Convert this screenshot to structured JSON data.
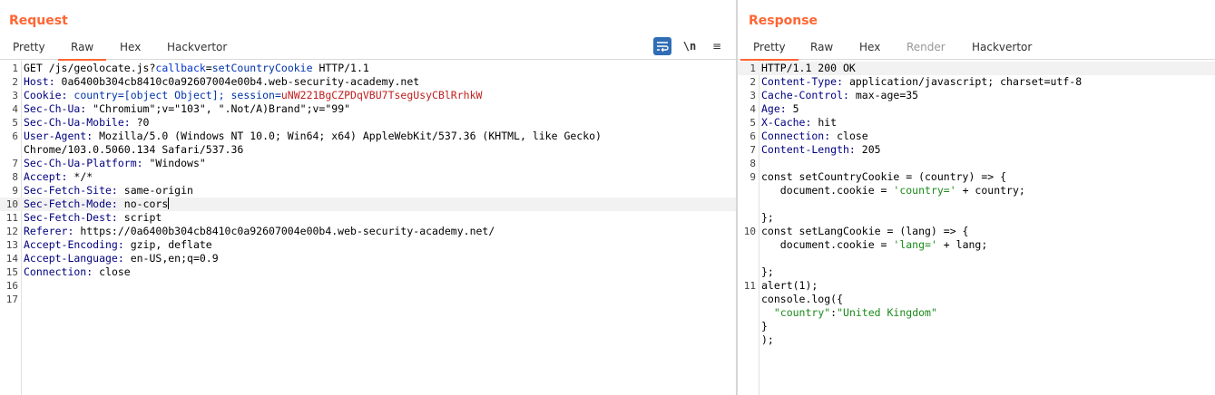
{
  "request": {
    "title": "Request",
    "tabs": [
      "Pretty",
      "Raw",
      "Hex",
      "Hackvertor"
    ],
    "active_tab": "Raw",
    "tools": {
      "newline_label": "\\n",
      "menu_label": "≡"
    },
    "lines": [
      {
        "n": "1",
        "method": "GET /js/geolocate.js?",
        "param": "callback",
        "eq": "=",
        "pvalue": "setCountryCookie",
        "rest": " HTTP/1.1"
      },
      {
        "n": "2",
        "key": "Host:",
        "value": " 0a6400b304cb8410c0a92607004e00b4.web-security-academy.net"
      },
      {
        "n": "3",
        "key": "Cookie:",
        "c1": " country=[object Object]; session=",
        "c2": "uNW221BgCZPDqVBU7TsegUsyCBlRrhkW"
      },
      {
        "n": "4",
        "key": "Sec-Ch-Ua:",
        "value": " \"Chromium\";v=\"103\", \".Not/A)Brand\";v=\"99\""
      },
      {
        "n": "5",
        "key": "Sec-Ch-Ua-Mobile:",
        "value": " ?0"
      },
      {
        "n": "6",
        "key": "User-Agent:",
        "value": " Mozilla/5.0 (Windows NT 10.0; Win64; x64) AppleWebKit/537.36 (KHTML, like Gecko)",
        "cont": "Chrome/103.0.5060.134 Safari/537.36"
      },
      {
        "n": "7",
        "key": "Sec-Ch-Ua-Platform:",
        "value": " \"Windows\""
      },
      {
        "n": "8",
        "key": "Accept:",
        "value": " */*"
      },
      {
        "n": "9",
        "key": "Sec-Fetch-Site:",
        "value": " same-origin"
      },
      {
        "n": "10",
        "key": "Sec-Fetch-Mode:",
        "value": " no-cors"
      },
      {
        "n": "11",
        "key": "Sec-Fetch-Dest:",
        "value": " script"
      },
      {
        "n": "12",
        "key": "Referer:",
        "value": " https://0a6400b304cb8410c0a92607004e00b4.web-security-academy.net/"
      },
      {
        "n": "13",
        "key": "Accept-Encoding:",
        "value": " gzip, deflate"
      },
      {
        "n": "14",
        "key": "Accept-Language:",
        "value": " en-US,en;q=0.9"
      },
      {
        "n": "15",
        "key": "Connection:",
        "value": " close"
      },
      {
        "n": "16"
      },
      {
        "n": "17"
      }
    ]
  },
  "response": {
    "title": "Response",
    "tabs": [
      "Pretty",
      "Raw",
      "Hex",
      "Render",
      "Hackvertor"
    ],
    "active_tab": "Pretty",
    "lines": [
      {
        "n": "1",
        "text": "HTTP/1.1 200 OK"
      },
      {
        "n": "2",
        "key": "Content-Type:",
        "value": " application/javascript; charset=utf-8"
      },
      {
        "n": "3",
        "key": "Cache-Control:",
        "value": " max-age=35"
      },
      {
        "n": "4",
        "key": "Age:",
        "value": " 5"
      },
      {
        "n": "5",
        "key": "X-Cache:",
        "value": " hit"
      },
      {
        "n": "6",
        "key": "Connection:",
        "value": " close"
      },
      {
        "n": "7",
        "key": "Content-Length:",
        "value": " 205"
      },
      {
        "n": "8"
      },
      {
        "n": "9",
        "text": "const setCountryCookie = (country) => {"
      },
      {
        "n": "",
        "pre": "   document.cookie = ",
        "str": "'country='",
        "post": " + country;"
      },
      {
        "n": ""
      },
      {
        "n": "",
        "text": "};"
      },
      {
        "n": "10",
        "text": "const setLangCookie = (lang) => {"
      },
      {
        "n": "",
        "pre": "   document.cookie = ",
        "str": "'lang='",
        "post": " + lang;"
      },
      {
        "n": ""
      },
      {
        "n": "",
        "text": "};"
      },
      {
        "n": "11",
        "text": "alert(1);"
      },
      {
        "n": "",
        "text": "console.log({"
      },
      {
        "n": "",
        "pre": "  ",
        "str": "\"country\"",
        "post": ":",
        "str2": "\"United Kingdom\""
      },
      {
        "n": "",
        "text": "}"
      },
      {
        "n": "",
        "text": ");"
      }
    ]
  }
}
